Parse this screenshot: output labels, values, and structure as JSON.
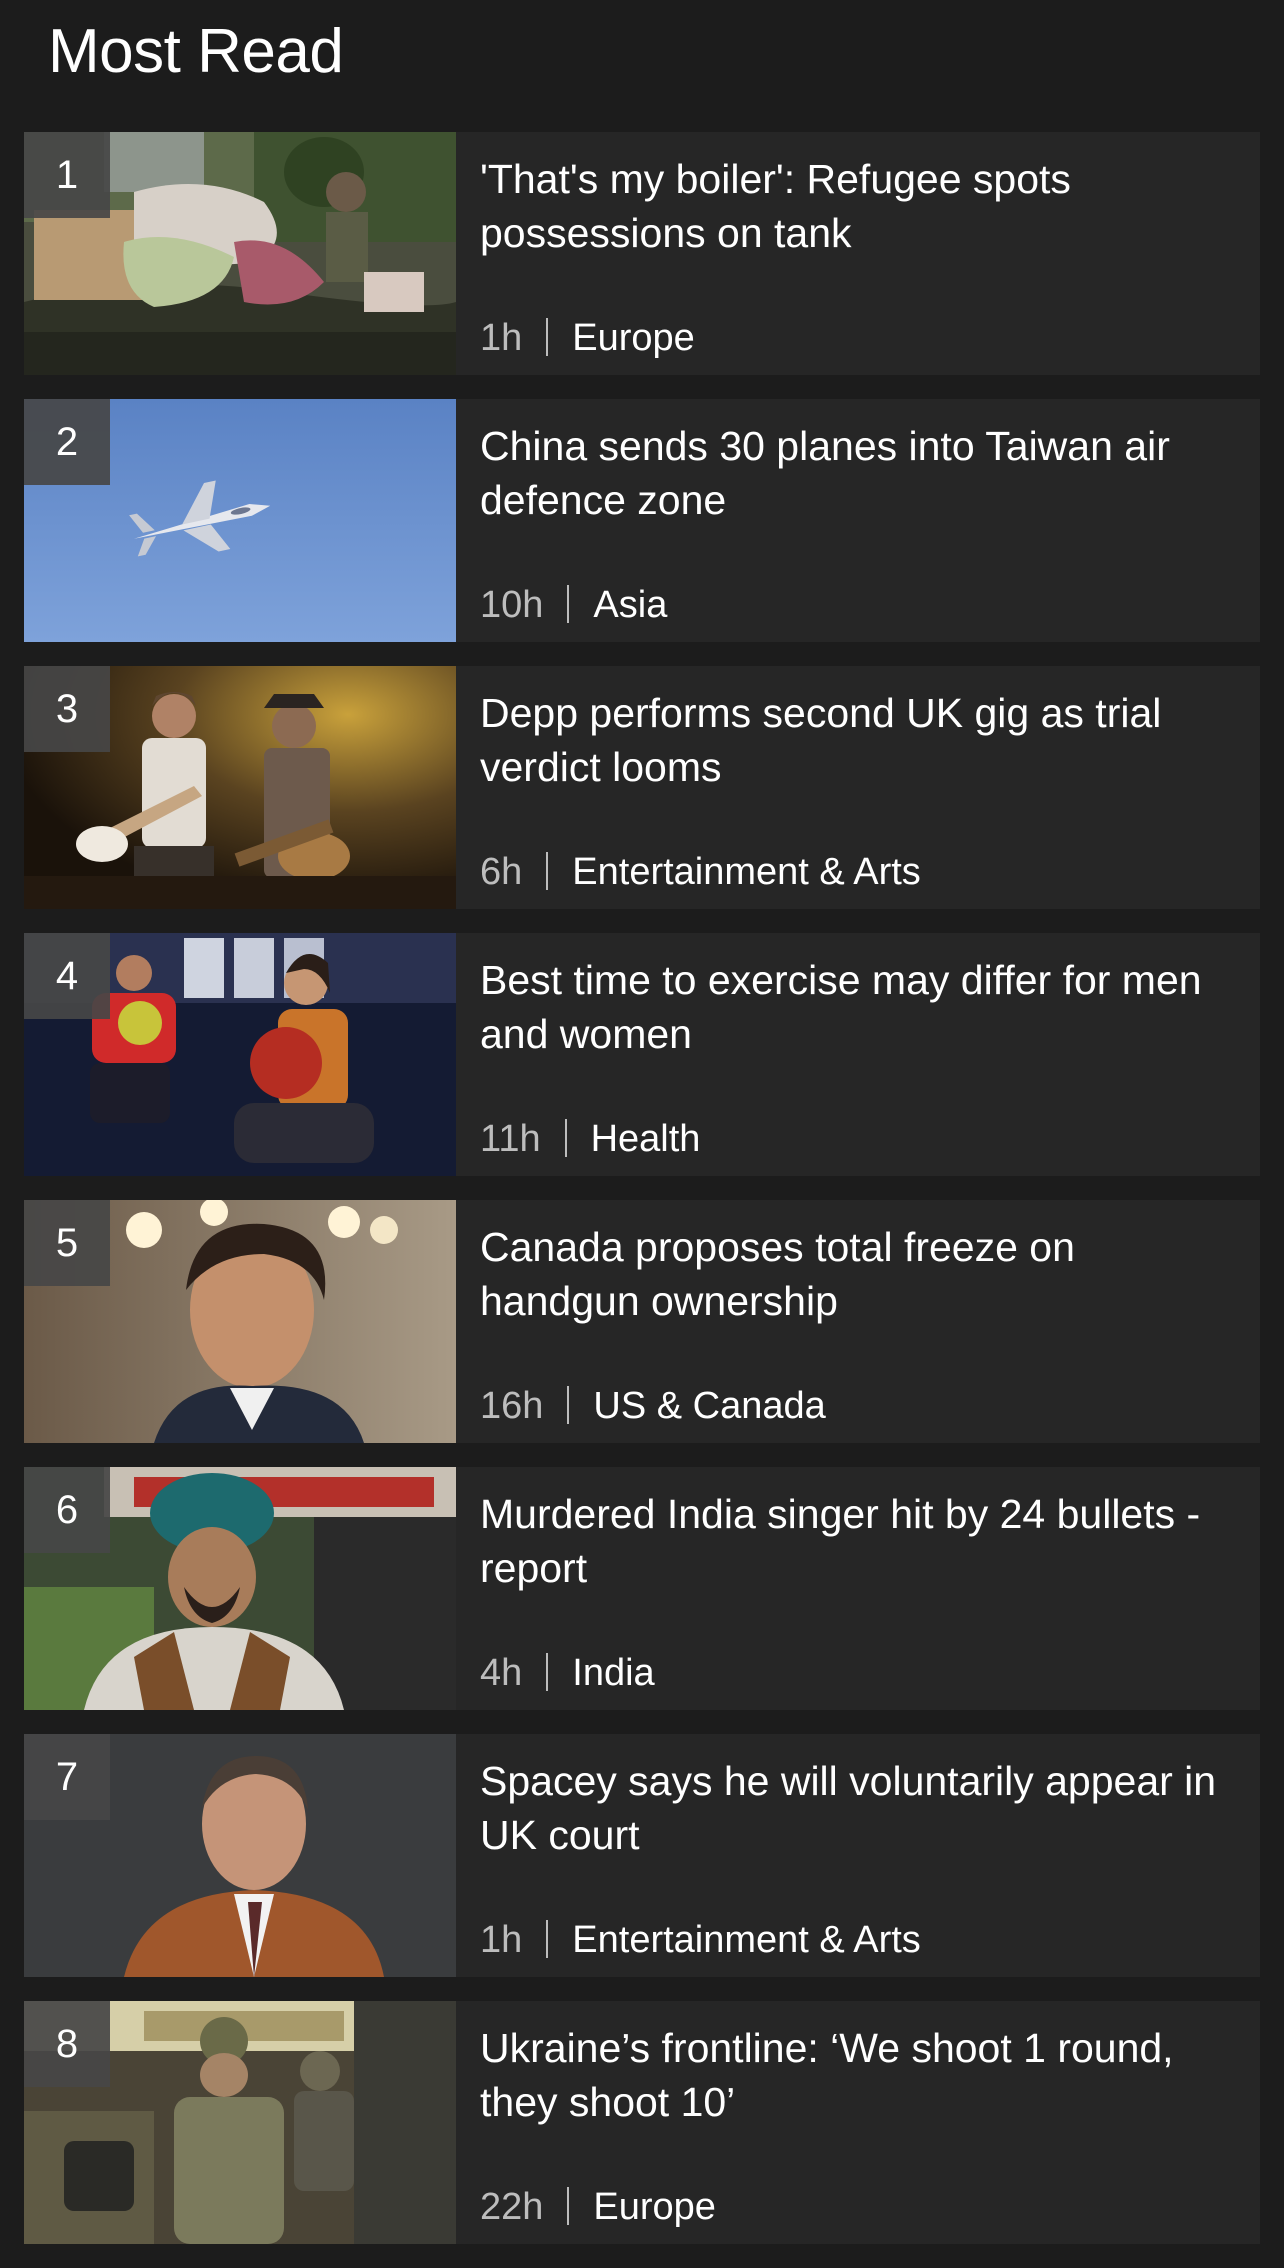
{
  "section": {
    "title": "Most Read"
  },
  "colors": {
    "background": "#1c1c1c",
    "card": "#262626",
    "rank_box": "#464646",
    "muted": "#bdbdbd"
  },
  "articles": [
    {
      "rank": "1",
      "headline": "'That's my boiler': Refugee spots possessions on tank",
      "age": "1h",
      "topic": "Europe",
      "image": "tank-with-belongings-photo"
    },
    {
      "rank": "2",
      "headline": "China sends 30 planes into Taiwan air defence zone",
      "age": "10h",
      "topic": "Asia",
      "image": "fighter-jet-photo"
    },
    {
      "rank": "3",
      "headline": "Depp performs second UK gig as trial verdict looms",
      "age": "6h",
      "topic": "Entertainment & Arts",
      "image": "guitarists-on-stage-photo"
    },
    {
      "rank": "4",
      "headline": "Best time to exercise may differ for men and women",
      "age": "11h",
      "topic": "Health",
      "image": "kettlebell-exercise-photo"
    },
    {
      "rank": "5",
      "headline": "Canada proposes total freeze on handgun ownership",
      "age": "16h",
      "topic": "US & Canada",
      "image": "politician-portrait-photo"
    },
    {
      "rank": "6",
      "headline": "Murdered India singer hit by 24 bullets - report",
      "age": "4h",
      "topic": "India",
      "image": "singer-in-turban-photo"
    },
    {
      "rank": "7",
      "headline": "Spacey says he will voluntarily appear in UK court",
      "age": "1h",
      "topic": "Entertainment & Arts",
      "image": "actor-portrait-photo"
    },
    {
      "rank": "8",
      "headline": "Ukraine’s frontline: ‘We shoot 1 round, they shoot 10’",
      "age": "22h",
      "topic": "Europe",
      "image": "soldiers-in-vehicle-photo"
    }
  ]
}
